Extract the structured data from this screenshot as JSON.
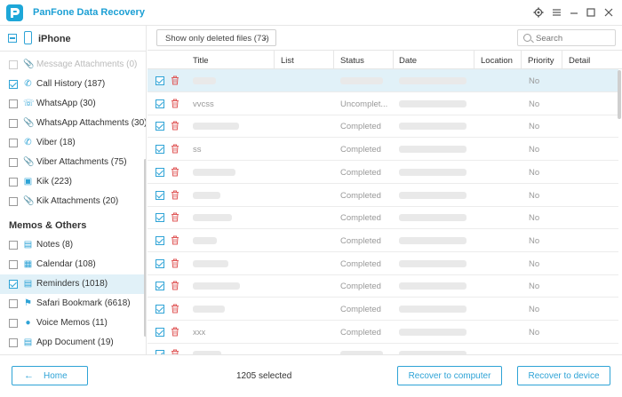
{
  "app": {
    "title": "PanFone Data Recovery",
    "accent_color": "#2ea3d6",
    "logo_icon": "app-logo-icon"
  },
  "window_controls": [
    "gear-icon",
    "menu-icon",
    "minimize-icon",
    "maximize-icon",
    "close-icon"
  ],
  "sidebar": {
    "device": "iPhone",
    "items": [
      {
        "label": "Message Attachments (0)",
        "icon": "paperclip-icon",
        "checked": false,
        "faded": true
      },
      {
        "label": "Call History (187)",
        "icon": "phone-icon",
        "checked": true
      },
      {
        "label": "WhatsApp (30)",
        "icon": "whatsapp-icon",
        "checked": false
      },
      {
        "label": "WhatsApp Attachments (30)",
        "icon": "paperclip-icon",
        "checked": false
      },
      {
        "label": "Viber (18)",
        "icon": "viber-icon",
        "checked": false
      },
      {
        "label": "Viber Attachments (75)",
        "icon": "paperclip-icon",
        "checked": false
      },
      {
        "label": "Kik (223)",
        "icon": "kik-icon",
        "checked": false
      },
      {
        "label": "Kik Attachments (20)",
        "icon": "paperclip-icon",
        "checked": false
      }
    ],
    "section_title": "Memos & Others",
    "memo_items": [
      {
        "label": "Notes (8)",
        "icon": "notes-icon",
        "checked": false
      },
      {
        "label": "Calendar (108)",
        "icon": "calendar-icon",
        "checked": false
      },
      {
        "label": "Reminders (1018)",
        "icon": "reminders-icon",
        "checked": true,
        "active": true
      },
      {
        "label": "Safari Bookmark (6618)",
        "icon": "bookmark-icon",
        "checked": false
      },
      {
        "label": "Voice Memos (11)",
        "icon": "microphone-icon",
        "checked": false
      },
      {
        "label": "App Document (19)",
        "icon": "document-icon",
        "checked": false
      }
    ]
  },
  "toolbar": {
    "filter_label": "Show only deleted files (73)",
    "search_placeholder": "Search"
  },
  "table": {
    "columns": [
      "Title",
      "List",
      "Status",
      "Date",
      "Location",
      "Priority",
      "Detail"
    ],
    "rows": [
      {
        "title": "",
        "status": "",
        "priority": "No",
        "highlight": true
      },
      {
        "title": "vvcss",
        "status": "Uncomplet...",
        "priority": "No"
      },
      {
        "title": "",
        "status": "Completed",
        "priority": "No"
      },
      {
        "title": "ss",
        "status": "Completed",
        "priority": "No"
      },
      {
        "title": "",
        "status": "Completed",
        "priority": "No"
      },
      {
        "title": "",
        "status": "Completed",
        "priority": "No"
      },
      {
        "title": "",
        "status": "Completed",
        "priority": "No"
      },
      {
        "title": "",
        "status": "Completed",
        "priority": "No"
      },
      {
        "title": "",
        "status": "Completed",
        "priority": "No"
      },
      {
        "title": "",
        "status": "Completed",
        "priority": "No"
      },
      {
        "title": "",
        "status": "Completed",
        "priority": "No"
      },
      {
        "title": "xxx",
        "status": "Completed",
        "priority": "No"
      },
      {
        "title": "",
        "status": "",
        "priority": ""
      }
    ]
  },
  "footer": {
    "home_label": "Home",
    "selected_text": "1205 selected",
    "recover_computer_label": "Recover to computer",
    "recover_device_label": "Recover to device"
  }
}
